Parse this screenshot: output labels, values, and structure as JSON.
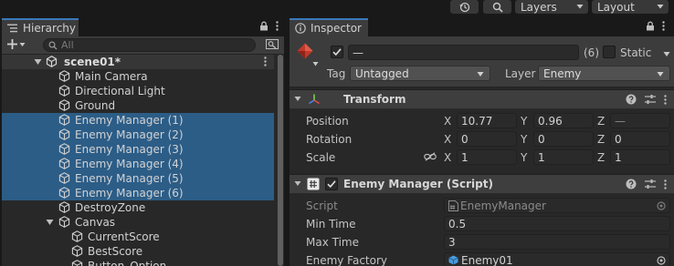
{
  "toolbar": {
    "history_icon": "history-icon",
    "search_icon": "search-icon",
    "layers_label": "Layers",
    "layout_label": "Layout"
  },
  "hierarchy": {
    "tab_label": "Hierarchy",
    "search_placeholder": "All",
    "scene": {
      "name": "scene01*"
    },
    "items": [
      {
        "label": "Main Camera",
        "depth": 1,
        "selected": false,
        "expandable": false
      },
      {
        "label": "Directional Light",
        "depth": 1,
        "selected": false,
        "expandable": false
      },
      {
        "label": "Ground",
        "depth": 1,
        "selected": false,
        "expandable": false
      },
      {
        "label": "Enemy Manager (1)",
        "depth": 1,
        "selected": true,
        "expandable": false
      },
      {
        "label": "Enemy Manager (2)",
        "depth": 1,
        "selected": true,
        "expandable": false
      },
      {
        "label": "Enemy Manager (3)",
        "depth": 1,
        "selected": true,
        "expandable": false
      },
      {
        "label": "Enemy Manager (4)",
        "depth": 1,
        "selected": true,
        "expandable": false
      },
      {
        "label": "Enemy Manager (5)",
        "depth": 1,
        "selected": true,
        "expandable": false
      },
      {
        "label": "Enemy Manager (6)",
        "depth": 1,
        "selected": true,
        "expandable": false
      },
      {
        "label": "DestroyZone",
        "depth": 1,
        "selected": false,
        "expandable": false
      },
      {
        "label": "Canvas",
        "depth": 1,
        "selected": false,
        "expandable": true
      },
      {
        "label": "CurrentScore",
        "depth": 2,
        "selected": false,
        "expandable": false
      },
      {
        "label": "BestScore",
        "depth": 2,
        "selected": false,
        "expandable": false
      },
      {
        "label": "Button_Option",
        "depth": 2,
        "selected": false,
        "expandable": false
      }
    ]
  },
  "inspector": {
    "tab_label": "Inspector",
    "gameobject": {
      "name_value": "—",
      "count_label": "(6)",
      "static_label": "Static",
      "tag_label": "Tag",
      "tag_value": "Untagged",
      "layer_label": "Layer",
      "layer_value": "Enemy"
    },
    "transform": {
      "title": "Transform",
      "position_label": "Position",
      "rotation_label": "Rotation",
      "scale_label": "Scale",
      "axis_x": "X",
      "axis_y": "Y",
      "axis_z": "Z",
      "position": {
        "x": "10.77",
        "y": "0.96",
        "z": "—"
      },
      "rotation": {
        "x": "0",
        "y": "0",
        "z": "0"
      },
      "scale": {
        "x": "1",
        "y": "1",
        "z": "1"
      }
    },
    "script_component": {
      "title": "Enemy Manager (Script)",
      "script_label": "Script",
      "script_value": "EnemyManager",
      "min_time_label": "Min Time",
      "min_time_value": "0.5",
      "max_time_label": "Max Time",
      "max_time_value": "3",
      "enemy_factory_label": "Enemy Factory",
      "enemy_factory_value": "Enemy01"
    }
  },
  "colors": {
    "selection": "#2c5d87",
    "tab_accent": "#3a79bb",
    "gameobject_icon": "#c0392b"
  }
}
